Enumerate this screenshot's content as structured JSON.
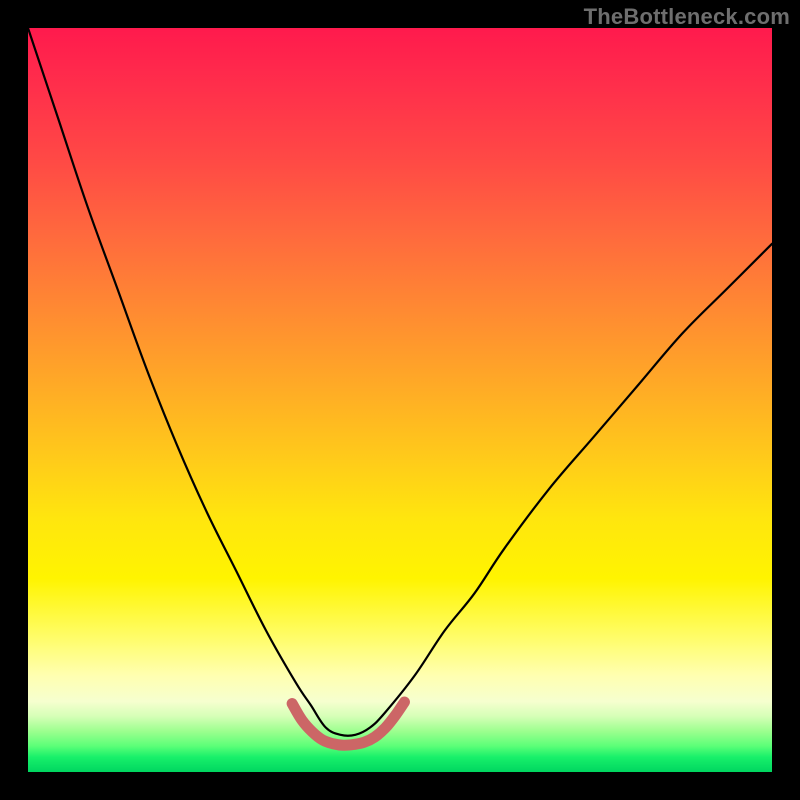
{
  "watermark": "TheBottleneck.com",
  "colors": {
    "frame_background": "#000000",
    "curve_stroke": "#000000",
    "bump_stroke": "#cc6666",
    "gradient_stops": [
      "#ff1a4d",
      "#ff2f4b",
      "#ff4a45",
      "#ff6a3d",
      "#ff8a32",
      "#ffaa26",
      "#ffcb1a",
      "#ffe60e",
      "#fff400",
      "#fffd6a",
      "#ffffb0",
      "#f6ffcf",
      "#d6ffb7",
      "#9dff8f",
      "#5cff78",
      "#18f06a",
      "#00d660"
    ]
  },
  "chart_data": {
    "type": "line",
    "title": "",
    "xlabel": "",
    "ylabel": "",
    "xlim": [
      0,
      100
    ],
    "ylim": [
      0,
      100
    ],
    "grid": false,
    "note": "x in [0,100]; y is relative height 0(bottom)–100(top). Visual bottleneck curve descends steeply from top-left to a flat minimum near x≈39–46, then rises less steeply toward upper right.",
    "series": [
      {
        "name": "bottleneck-curve",
        "x": [
          0,
          4,
          8,
          12,
          16,
          20,
          24,
          28,
          32,
          36,
          38,
          40,
          42,
          44,
          46,
          48,
          52,
          56,
          60,
          64,
          70,
          76,
          82,
          88,
          94,
          100
        ],
        "y": [
          100,
          88,
          76,
          65,
          54,
          44,
          35,
          27,
          19,
          12,
          9,
          6,
          5,
          5,
          6,
          8,
          13,
          19,
          24,
          30,
          38,
          45,
          52,
          59,
          65,
          71
        ]
      },
      {
        "name": "min-highlight-bump",
        "x": [
          35.5,
          36.8,
          38.2,
          39.6,
          41.0,
          42.4,
          43.8,
          45.2,
          46.6,
          48.0,
          49.3,
          50.6
        ],
        "y": [
          9.2,
          7.0,
          5.4,
          4.3,
          3.8,
          3.6,
          3.7,
          4.0,
          4.7,
          5.9,
          7.5,
          9.4
        ]
      }
    ]
  }
}
